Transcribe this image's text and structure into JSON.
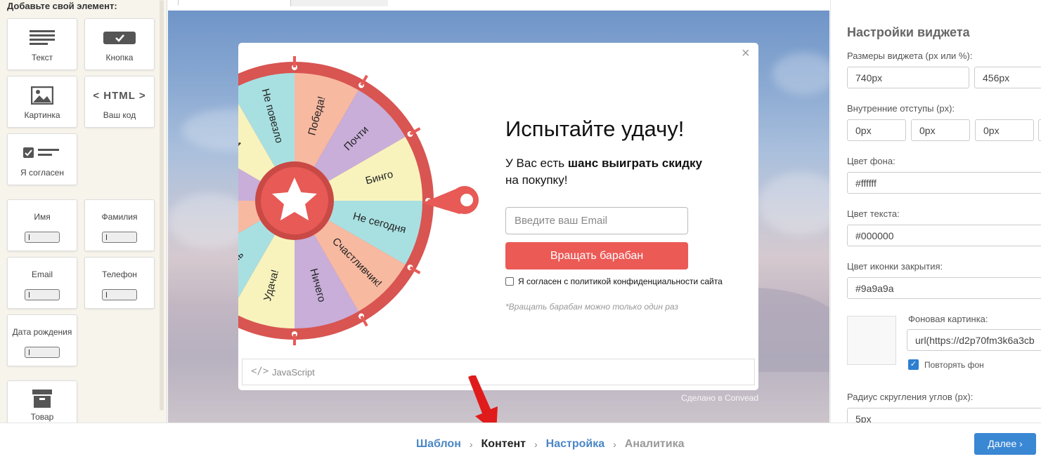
{
  "sidebar": {
    "title": "Добавьте свой элемент:",
    "tiles": [
      {
        "label": "Текст",
        "icon": "text-icon"
      },
      {
        "label": "Кнопка",
        "icon": "button-icon"
      },
      {
        "label": "Картинка",
        "icon": "image-icon"
      },
      {
        "label": "Ваш код",
        "icon": "html-icon",
        "icon_text": "< HTML >"
      },
      {
        "label": "Я согласен",
        "icon": "checkbox-icon"
      },
      {
        "label": "Имя",
        "icon": "field-icon"
      },
      {
        "label": "Фамилия",
        "icon": "field-icon"
      },
      {
        "label": "Email",
        "icon": "field-icon"
      },
      {
        "label": "Телефон",
        "icon": "field-icon"
      },
      {
        "label": "Дата рождения",
        "icon": "field-icon"
      },
      {
        "label": "Товар",
        "icon": "box-icon"
      }
    ]
  },
  "widget": {
    "title": "Испытайте удачу!",
    "text_before": "У Вас есть ",
    "text_bold": "шанс выиграть скидку",
    "text_after": "на покупку!",
    "email_placeholder": "Введите ваш Email",
    "spin_button": "Вращать барабан",
    "consent": "Я согласен с политикой конфиденциальности сайта",
    "note": "*Вращать барабан можно только один раз",
    "js_label": "JavaScript",
    "made_by": "Сделано в Convead",
    "close": "×",
    "wheel_segments": [
      {
        "label": "Победа!",
        "color": "#f8b9a1"
      },
      {
        "label": "Почти",
        "color": "#c8aed9"
      },
      {
        "label": "Бинго",
        "color": "#f8f3bd"
      },
      {
        "label": "Не сегодня",
        "color": "#a8e0e2"
      },
      {
        "label": "Счастливчик!",
        "color": "#f8b9a1"
      },
      {
        "label": "Ничего",
        "color": "#c8aed9"
      },
      {
        "label": "Удача!",
        "color": "#f8f3bd"
      },
      {
        "label": "Жаль",
        "color": "#a8e0e2"
      },
      {
        "label": "",
        "color": "#f8b9a1"
      },
      {
        "label": "",
        "color": "#c8aed9"
      },
      {
        "label": "Вам",
        "color": "#f8f3bd"
      },
      {
        "label": "Не повезло",
        "color": "#a8e0e2"
      }
    ],
    "accent_color": "#ec5a56"
  },
  "settings": {
    "title": "Настройки виджета",
    "size_label": "Размеры виджета (px или %):",
    "width": "740px",
    "height": "456px",
    "padding_label": "Внутренние отступы (px):",
    "padding": [
      "0px",
      "0px",
      "0px"
    ],
    "bg_color_label": "Цвет фона:",
    "bg_color": "#ffffff",
    "text_color_label": "Цвет текста:",
    "text_color": "#000000",
    "close_color_label": "Цвет иконки закрытия:",
    "close_color": "#9a9a9a",
    "bg_image_label": "Фоновая картинка:",
    "bg_image": "url(https://d2p70fm3k6a3cb",
    "repeat_bg": "Повторять фон",
    "radius_label": "Радиус скругления углов (px):",
    "radius": "5px"
  },
  "steps": {
    "items": [
      {
        "label": "Шаблон",
        "state": "link"
      },
      {
        "label": "Контент",
        "state": "current"
      },
      {
        "label": "Настройка",
        "state": "link"
      },
      {
        "label": "Аналитика",
        "state": "disabled"
      }
    ],
    "separator": "›",
    "next": "Далее ›"
  }
}
